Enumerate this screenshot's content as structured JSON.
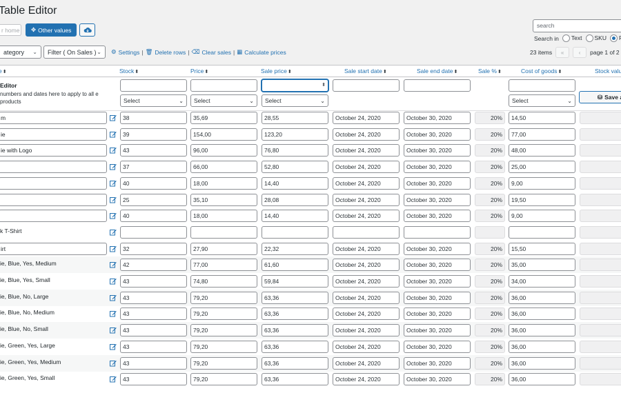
{
  "app": {
    "title": "Table Editor",
    "home_placeholder": "r home",
    "other_values_label": "Other values",
    "category_filter": "ategory",
    "sales_filter": "Filter ( On Sales )",
    "links": [
      "Settings",
      "Delete rows",
      "Clear sales",
      "Calculate prices"
    ]
  },
  "search": {
    "placeholder": "search",
    "search_in_label": "Search in",
    "options": [
      "Text",
      "SKU",
      "R"
    ],
    "selected": "R"
  },
  "paging": {
    "items_label": "23 items",
    "page_label": "page 1 of 2",
    "first": "«",
    "prev": "‹",
    "next": "›"
  },
  "table": {
    "headers": [
      "e",
      "Stock",
      "Price",
      "Sale price",
      "Sale start date",
      "Sale end date",
      "Sale %",
      "Cost of goods",
      "Stock valu"
    ],
    "bulk_editor": {
      "title": "Editor",
      "description": "numbers and dates here to apply to all e products",
      "select_label": "Select",
      "save_label": "Save a"
    },
    "rows": [
      {
        "name": "m",
        "boxed": true,
        "stock": "38",
        "price": "35,69",
        "sale": "28,55",
        "start": "October 24, 2020",
        "end": "October 30, 2020",
        "pct": "20%",
        "cost": "14,50"
      },
      {
        "name": "ie",
        "boxed": true,
        "stock": "39",
        "price": "154,00",
        "sale": "123,20",
        "start": "October 24, 2020",
        "end": "October 30, 2020",
        "pct": "20%",
        "cost": "77,00"
      },
      {
        "name": "ie with Logo",
        "boxed": true,
        "stock": "43",
        "price": "96,00",
        "sale": "76,80",
        "start": "October 24, 2020",
        "end": "October 30, 2020",
        "pct": "20%",
        "cost": "48,00"
      },
      {
        "name": "",
        "boxed": true,
        "stock": "37",
        "price": "66,00",
        "sale": "52,80",
        "start": "October 24, 2020",
        "end": "October 30, 2020",
        "pct": "20%",
        "cost": "25,00"
      },
      {
        "name": "",
        "boxed": true,
        "stock": "40",
        "price": "18,00",
        "sale": "14,40",
        "start": "October 24, 2020",
        "end": "October 30, 2020",
        "pct": "20%",
        "cost": "9,00"
      },
      {
        "name": "",
        "boxed": true,
        "stock": "25",
        "price": "35,10",
        "sale": "28,08",
        "start": "October 24, 2020",
        "end": "October 30, 2020",
        "pct": "20%",
        "cost": "19,50"
      },
      {
        "name": "",
        "boxed": true,
        "stock": "40",
        "price": "18,00",
        "sale": "14,40",
        "start": "October 24, 2020",
        "end": "October 30, 2020",
        "pct": "20%",
        "cost": "9,00"
      },
      {
        "name": "k T-Shirt",
        "boxed": false,
        "stock": "",
        "price": "",
        "sale": "",
        "start": "",
        "end": "",
        "pct": "",
        "cost": ""
      },
      {
        "name": "irt",
        "boxed": true,
        "stock": "32",
        "price": "27,90",
        "sale": "22,32",
        "start": "October 24, 2020",
        "end": "October 30, 2020",
        "pct": "20%",
        "cost": "15,50"
      },
      {
        "name": "ie, Blue, Yes, Medium",
        "boxed": false,
        "stock": "42",
        "price": "77,00",
        "sale": "61,60",
        "start": "October 24, 2020",
        "end": "October 30, 2020",
        "pct": "20%",
        "cost": "35,00"
      },
      {
        "name": "ie, Blue, Yes, Small",
        "boxed": false,
        "stock": "43",
        "price": "74,80",
        "sale": "59,84",
        "start": "October 24, 2020",
        "end": "October 30, 2020",
        "pct": "20%",
        "cost": "34,00"
      },
      {
        "name": "ie, Blue, No, Large",
        "boxed": false,
        "stock": "43",
        "price": "79,20",
        "sale": "63,36",
        "start": "October 24, 2020",
        "end": "October 30, 2020",
        "pct": "20%",
        "cost": "36,00"
      },
      {
        "name": "ie, Blue, No, Medium",
        "boxed": false,
        "stock": "43",
        "price": "79,20",
        "sale": "63,36",
        "start": "October 24, 2020",
        "end": "October 30, 2020",
        "pct": "20%",
        "cost": "36,00"
      },
      {
        "name": "ie, Blue, No, Small",
        "boxed": false,
        "stock": "43",
        "price": "79,20",
        "sale": "63,36",
        "start": "October 24, 2020",
        "end": "October 30, 2020",
        "pct": "20%",
        "cost": "36,00"
      },
      {
        "name": "ie, Green, Yes, Large",
        "boxed": false,
        "stock": "43",
        "price": "79,20",
        "sale": "63,36",
        "start": "October 24, 2020",
        "end": "October 30, 2020",
        "pct": "20%",
        "cost": "36,00"
      },
      {
        "name": "ie, Green, Yes, Medium",
        "boxed": false,
        "stock": "43",
        "price": "79,20",
        "sale": "63,36",
        "start": "October 24, 2020",
        "end": "October 30, 2020",
        "pct": "20%",
        "cost": "36,00"
      },
      {
        "name": "ie, Green, Yes, Small",
        "boxed": false,
        "stock": "43",
        "price": "79,20",
        "sale": "63,36",
        "start": "October 24, 2020",
        "end": "October 30, 2020",
        "pct": "20%",
        "cost": "36,00"
      }
    ]
  },
  "colors": {
    "accent": "#2271b1",
    "border": "#8c8f94",
    "background": "#f1f1f1"
  },
  "icons": [
    "move-icon",
    "cloud-icon",
    "gear-icon",
    "trash-icon",
    "eraser-icon",
    "calculator-icon",
    "sort-icon",
    "edit-icon",
    "database-icon",
    "chevron-down-icon"
  ]
}
